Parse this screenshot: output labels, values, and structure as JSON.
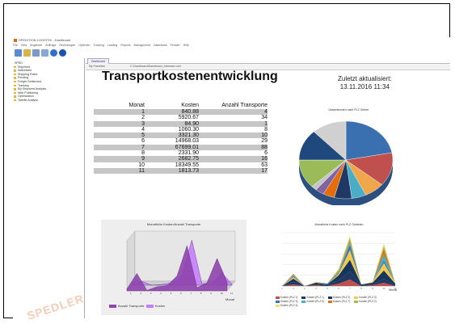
{
  "window": {
    "title": "SPEDITION LOGISTIK - Dashboard",
    "menu": [
      "File",
      "View",
      "Angebote",
      "Aufträge",
      "Rechnungen",
      "Optionen",
      "Tracking",
      "Loading",
      "Reports",
      "Management",
      "Datenbank",
      "Fenster",
      "Hilfe"
    ]
  },
  "sidebar": {
    "root": "SPED",
    "items": [
      "Shipment",
      "Addresses",
      "Shipping Rates",
      "Pending",
      "Freight Settlement",
      "Tracking",
      "My Shipment Analysis",
      "Web Publishing",
      "Optimization",
      "Tabelle Analyse"
    ]
  },
  "tab": {
    "label": "Dashboard"
  },
  "address": {
    "label": "My Favorites",
    "path": "C:\\Dashboard\\Dashboard_Adressen.xml"
  },
  "report": {
    "title": "Transportkostenentwicklung",
    "updated_label": "Zuletzt aktualisiert:",
    "updated_value": "13.11.2016 11:34"
  },
  "table": {
    "headers": [
      "Monat",
      "Kosten",
      "Anzahl Transporte"
    ],
    "rows": [
      [
        "1",
        "840.88",
        "4"
      ],
      [
        "2",
        "5920.67",
        "34"
      ],
      [
        "3",
        "84.90",
        "1"
      ],
      [
        "4",
        "1060.30",
        "8"
      ],
      [
        "5",
        "3321.30",
        "10"
      ],
      [
        "6",
        "14968.03",
        "29"
      ],
      [
        "7",
        "67699.01",
        "88"
      ],
      [
        "8",
        "2331.90",
        "6"
      ],
      [
        "9",
        "2682.75",
        "16"
      ],
      [
        "10",
        "18349.55",
        "63"
      ],
      [
        "11",
        "1813.73",
        "17"
      ]
    ]
  },
  "chart_data": [
    {
      "type": "pie",
      "title": "Gesamtkosten nach PLZ Gebiet",
      "values": [
        22,
        14,
        7,
        5,
        6,
        4,
        3,
        2,
        12,
        13,
        12
      ],
      "colors": [
        "#3a6fb0",
        "#c0504d",
        "#f0a64a",
        "#4bacc6",
        "#1f3864",
        "#e46c0a",
        "#8064a2",
        "#c6c6c6",
        "#9bbb59",
        "#1f497d",
        "#d0d0d0"
      ]
    },
    {
      "type": "area",
      "title": "Monatliche Kosten/Anzahl Transporte",
      "categories": [
        "1",
        "2",
        "3",
        "4",
        "5",
        "6",
        "7",
        "8",
        "9",
        "10",
        "11"
      ],
      "series": [
        {
          "name": "Anzahl Transporte",
          "values": [
            4,
            34,
            1,
            8,
            10,
            29,
            88,
            6,
            16,
            63,
            17
          ]
        },
        {
          "name": "Kosten",
          "values": [
            840.88,
            5920.67,
            84.9,
            1060.3,
            3321.3,
            14968.03,
            67699.01,
            2331.9,
            2682.75,
            18349.55,
            1813.73
          ]
        }
      ],
      "xlabel": "Monat",
      "colors": [
        "#8e44ad",
        "#c77dff"
      ]
    },
    {
      "type": "area",
      "title": "Monatliche Kosten nach PLZ Gebieten",
      "categories": [
        "1",
        "2",
        "3",
        "4",
        "5",
        "6",
        "7",
        "8",
        "9",
        "10",
        "11"
      ],
      "series": [
        {
          "name": "Kosten (PLZ 1)",
          "values": [
            0,
            2,
            0,
            1,
            0,
            3,
            8,
            0,
            1,
            4,
            0
          ]
        },
        {
          "name": "Kosten (PLZ 1)",
          "values": [
            0,
            3,
            0,
            1,
            1,
            4,
            10,
            1,
            1,
            5,
            1
          ]
        },
        {
          "name": "Kosten (PLZ 2)",
          "values": [
            0,
            4,
            0,
            2,
            1,
            6,
            14,
            1,
            2,
            10,
            2
          ]
        },
        {
          "name": "Kosten (PLZ 3)",
          "values": [
            0,
            2,
            0,
            1,
            0,
            2,
            12,
            0,
            1,
            9,
            1
          ]
        },
        {
          "name": "Kosten (PLZ 3)",
          "values": [
            0,
            1,
            0,
            0,
            1,
            1,
            6,
            0,
            0,
            3,
            0
          ]
        },
        {
          "name": "Kosten (PLZ 5)",
          "values": [
            0,
            1,
            0,
            0,
            0,
            1,
            3,
            0,
            0,
            8,
            0
          ]
        },
        {
          "name": "Kosten (PLZ 7)",
          "values": [
            0,
            1,
            0,
            0,
            0,
            1,
            2,
            0,
            0,
            6,
            0
          ]
        },
        {
          "name": "Kosten (PLZ 2)",
          "values": [
            0,
            1,
            0,
            0,
            0,
            2,
            4,
            0,
            0,
            4,
            0
          ]
        },
        {
          "name": "Kosten (PLZ 4)",
          "values": [
            0,
            0,
            0,
            0,
            0,
            1,
            2,
            0,
            0,
            3,
            0
          ]
        }
      ],
      "xlabel": "Monat",
      "colors": [
        "#c0504d",
        "#1f3864",
        "#17365d",
        "#f2c94c",
        "#3a6fb0",
        "#4bacc6",
        "#e46c0a",
        "#9bbb59",
        "#f7dc6f"
      ]
    }
  ],
  "watermark": "SPEDLER"
}
